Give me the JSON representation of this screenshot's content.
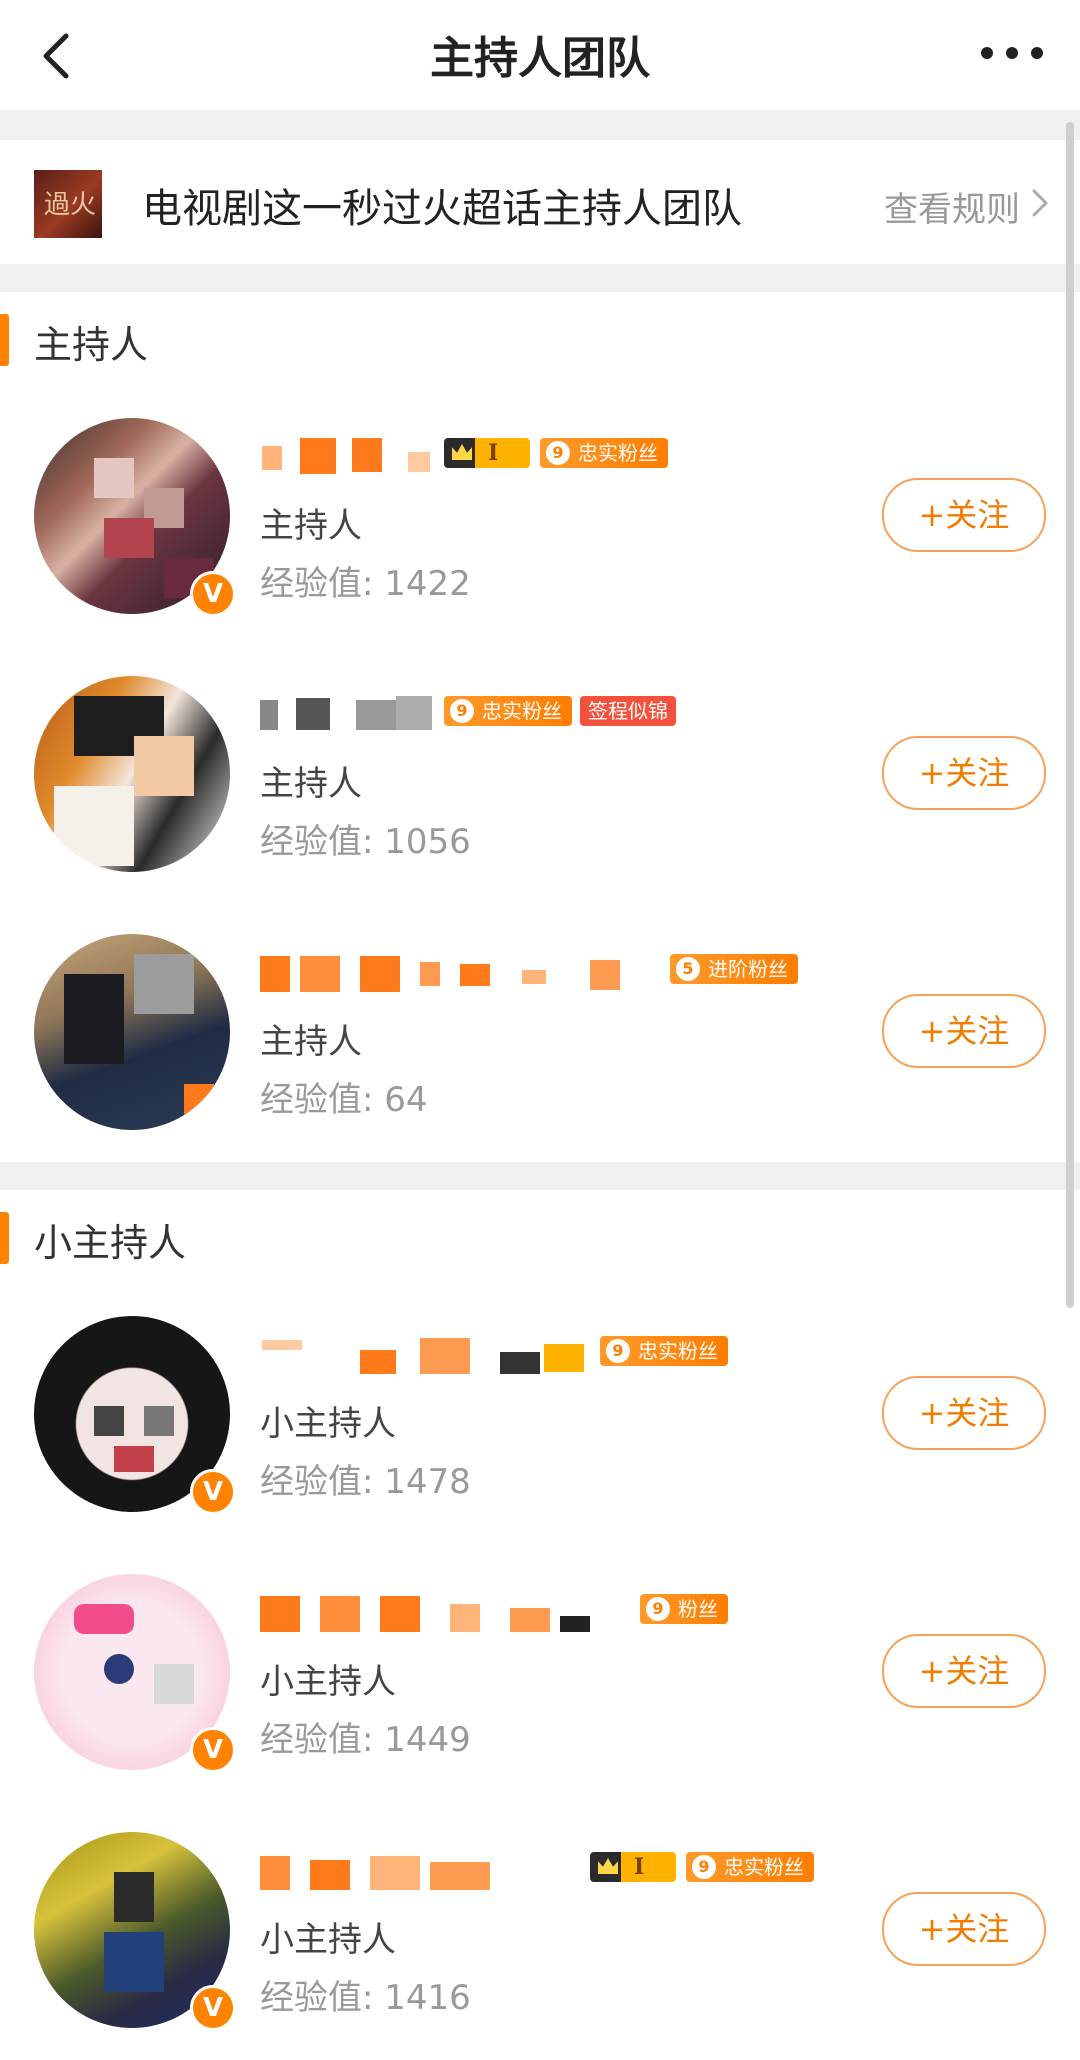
{
  "header": {
    "title": "主持人团队",
    "back_icon": "chevron-left-icon",
    "more_icon": "more-dots-icon"
  },
  "topic": {
    "cover_text": "過火",
    "name": "电视剧这一秒过火超话主持人团队",
    "rules_link": "查看规则"
  },
  "sections": [
    {
      "title": "主持人",
      "members": [
        {
          "role": "主持人",
          "experience": "经验值: 1422",
          "follow": "+关注",
          "verified": true,
          "badges": {
            "crown": "I",
            "fans_level": "9",
            "fans_label": "忠实粉丝",
            "extra": ""
          }
        },
        {
          "role": "主持人",
          "experience": "经验值: 1056",
          "follow": "+关注",
          "verified": false,
          "badges": {
            "crown": "",
            "fans_level": "9",
            "fans_label": "忠实粉丝",
            "extra": "签程似锦"
          }
        },
        {
          "role": "主持人",
          "experience": "经验值: 64",
          "follow": "+关注",
          "verified": false,
          "badges": {
            "crown": "",
            "fans_level": "5",
            "fans_label": "进阶粉丝",
            "extra": ""
          }
        }
      ]
    },
    {
      "title": "小主持人",
      "members": [
        {
          "role": "小主持人",
          "experience": "经验值: 1478",
          "follow": "+关注",
          "verified": true,
          "badges": {
            "crown": "",
            "fans_level": "9",
            "fans_label": "忠实粉丝",
            "extra": ""
          }
        },
        {
          "role": "小主持人",
          "experience": "经验值: 1449",
          "follow": "+关注",
          "verified": true,
          "badges": {
            "crown": "",
            "fans_level": "9",
            "fans_label": "粉丝",
            "extra": ""
          }
        },
        {
          "role": "小主持人",
          "experience": "经验值: 1416",
          "follow": "+关注",
          "verified": true,
          "badges": {
            "crown": "I",
            "fans_level": "9",
            "fans_label": "忠实粉丝",
            "extra": ""
          }
        }
      ]
    }
  ],
  "colors": {
    "accent": "#ff8200",
    "follow_border": "#f5a25d",
    "background_gap": "#f0f0f0"
  }
}
